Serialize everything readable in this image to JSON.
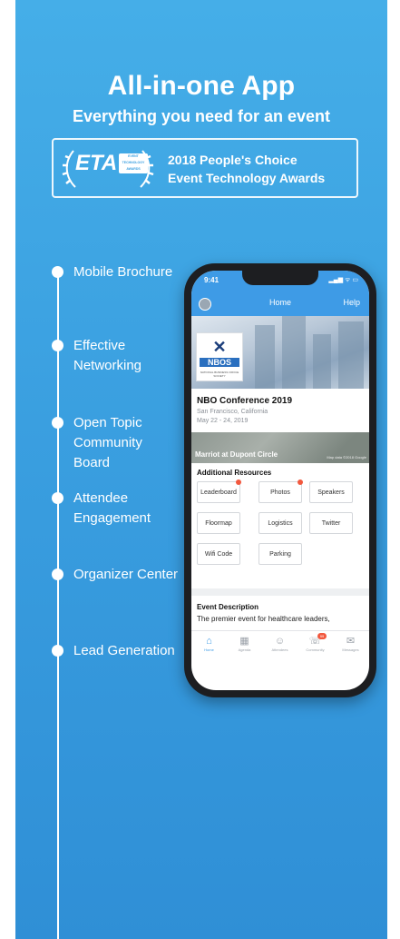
{
  "hero": {
    "title": "All-in-one App",
    "subtitle": "Everything you need for an event"
  },
  "award": {
    "logo_text": "ETA",
    "logo_small": "EVENT TECHNOLOGY AWARDS",
    "line1": "2018 People's Choice",
    "line2": "Event Technology Awards"
  },
  "features": [
    "Mobile Brochure",
    "Effective Networking",
    "Open Topic Community Board",
    "Attendee Engagement",
    "Organizer Center",
    "Lead Generation"
  ],
  "phone": {
    "time": "9:41",
    "status": "▂▄▆ ᯤ ▭",
    "home": "Home",
    "help": "Help",
    "logo_mark": "✕",
    "logo_name": "NBOS",
    "logo_tagline": "NATIONAL BUSINESS OFFICE SOCIETY",
    "conference_title": "NBO Conference 2019",
    "location": "San Francisco, California",
    "dates": "May 22 - 24, 2019",
    "map_label": "Marriot at Dupont Circle",
    "map_legal": "Map data ©2018 Google",
    "resources_title": "Additional Resources",
    "resources": [
      "Leaderboard",
      "Photos",
      "Speakers",
      "Floormap",
      "Logistics",
      "Twitter",
      "Wifi Code",
      "Parking"
    ],
    "description_title": "Event Description",
    "description_text": "The premier event for healthcare leaders,",
    "tabs": [
      "Home",
      "Agenda",
      "Attendees",
      "Community",
      "Messages"
    ],
    "community_badge": "99"
  },
  "colors": {
    "panel_top": "#45aee8",
    "panel_bottom": "#2f8fd6",
    "app_blue": "#3e9be6",
    "badge_red": "#f2583e"
  },
  "icons": [
    "laurel-icon",
    "home-icon",
    "agenda-icon",
    "attendees-icon",
    "community-icon",
    "messages-icon"
  ]
}
